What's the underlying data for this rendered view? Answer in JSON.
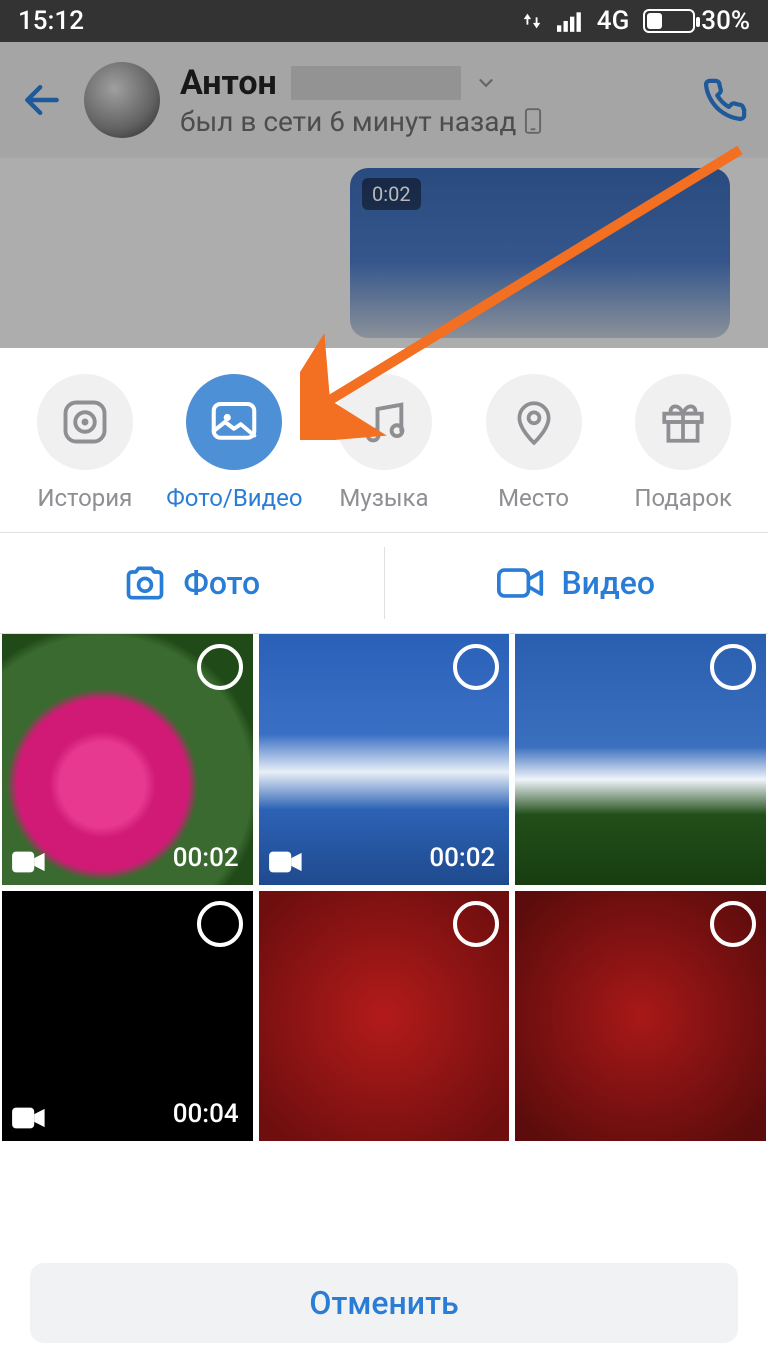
{
  "status_bar": {
    "time": "15:12",
    "network": "4G",
    "battery_pct": "30%"
  },
  "chat_header": {
    "back_icon": "back-arrow",
    "contact_name": "Антон",
    "status": "был в сети 6 минут назад",
    "dropdown_icon": "chevron-down",
    "call_icon": "phone"
  },
  "chat_body": {
    "msg_duration": "0:02"
  },
  "sheet": {
    "attach_options": [
      {
        "icon": "story",
        "label": "История",
        "active": false
      },
      {
        "icon": "media",
        "label": "Фото/Видео",
        "active": true
      },
      {
        "icon": "music",
        "label": "Музыка",
        "active": false
      },
      {
        "icon": "place",
        "label": "Место",
        "active": false
      },
      {
        "icon": "gift",
        "label": "Подарок",
        "active": false
      }
    ],
    "tabs": {
      "photo": "Фото",
      "video": "Видео"
    },
    "gallery": [
      {
        "type": "video",
        "duration": "00:02",
        "style": "flowers"
      },
      {
        "type": "video",
        "duration": "00:02",
        "style": "sky"
      },
      {
        "type": "photo",
        "style": "sky2"
      },
      {
        "type": "video",
        "duration": "00:04",
        "style": "black"
      },
      {
        "type": "photo",
        "style": "red1"
      },
      {
        "type": "photo",
        "style": "red2"
      }
    ],
    "cancel": "Отменить"
  },
  "colors": {
    "accent": "#2a7dd6",
    "annotation": "#f36f21"
  }
}
